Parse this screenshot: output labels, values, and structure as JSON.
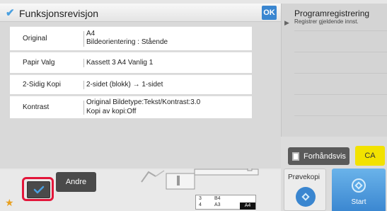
{
  "dialog": {
    "title": "Funksjonsrevisjon",
    "ok_label": "OK",
    "rows": [
      {
        "label": "Original",
        "value_line1": "A4",
        "value_line2": "Bildeorientering : Stående"
      },
      {
        "label": "Papir Valg",
        "value_line1": "Kassett 3  A4  Vanlig 1"
      },
      {
        "label": "2-Sidig Kopi",
        "value_line1": "2-sidet (blokk) → 1-sidet"
      },
      {
        "label": "Kontrast",
        "value_line1": "Original Bildetype:Tekst/Kontrast:3.0",
        "value_line2": "Kopi av kopi:Off"
      }
    ]
  },
  "program_panel": {
    "title": "Programregistrering",
    "subtitle": "Registrer gjeldende innst."
  },
  "buttons": {
    "preview": "Forhåndsvis",
    "ca": "CA",
    "proof": "Prøvekopi",
    "start": "Start",
    "andre": "Andre"
  },
  "trays": {
    "row1_num": "3",
    "row1_size": "B4",
    "row2_num": "4",
    "row2_size": "A3",
    "selected_size": "A4"
  },
  "colors": {
    "accent_blue": "#3a86d0",
    "highlight_red": "#e3163a",
    "ca_yellow": "#f2e200"
  }
}
